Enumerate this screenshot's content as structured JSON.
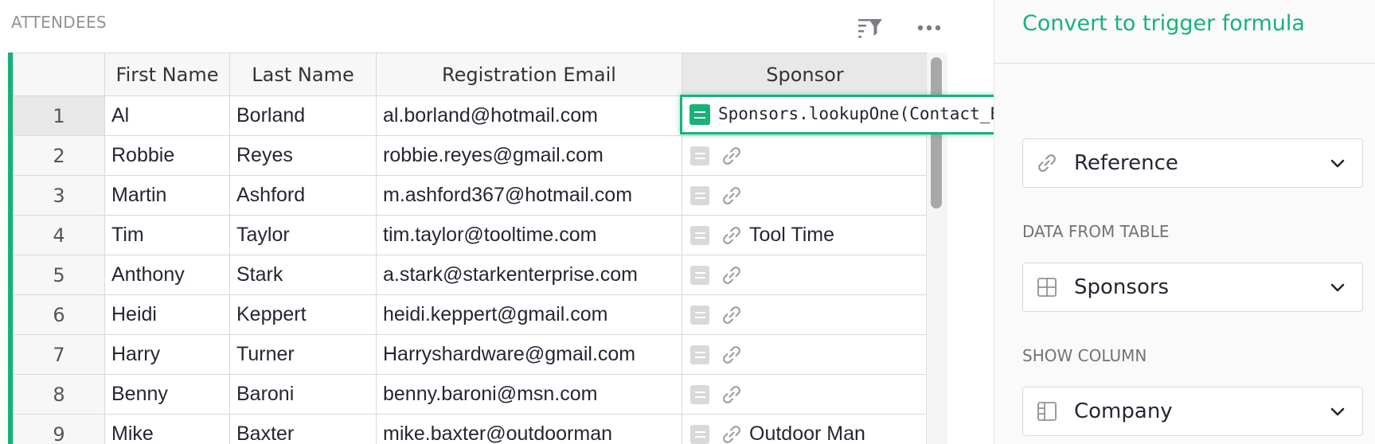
{
  "section": {
    "title": "ATTENDEES"
  },
  "columns": [
    "First Name",
    "Last Name",
    "Registration Email",
    "Sponsor"
  ],
  "rows": [
    {
      "num": "1",
      "first": "Al",
      "last": "Borland",
      "email": "al.borland@hotmail.com",
      "sponsor": ""
    },
    {
      "num": "2",
      "first": "Robbie",
      "last": "Reyes",
      "email": "robbie.reyes@gmail.com",
      "sponsor": ""
    },
    {
      "num": "3",
      "first": "Martin",
      "last": "Ashford",
      "email": "m.ashford367@hotmail.com",
      "sponsor": ""
    },
    {
      "num": "4",
      "first": "Tim",
      "last": "Taylor",
      "email": "tim.taylor@tooltime.com",
      "sponsor": "Tool Time"
    },
    {
      "num": "5",
      "first": "Anthony",
      "last": "Stark",
      "email": "a.stark@starkenterprise.com",
      "sponsor": ""
    },
    {
      "num": "6",
      "first": "Heidi",
      "last": "Keppert",
      "email": "heidi.keppert@gmail.com",
      "sponsor": ""
    },
    {
      "num": "7",
      "first": "Harry",
      "last": "Turner",
      "email": "Harryshardware@gmail.com",
      "sponsor": ""
    },
    {
      "num": "8",
      "first": "Benny",
      "last": "Baroni",
      "email": "benny.baroni@msn.com",
      "sponsor": ""
    },
    {
      "num": "9",
      "first": "Mike",
      "last": "Baxter",
      "email": "mike.baxter@outdoorman",
      "sponsor": "Outdoor Man"
    }
  ],
  "formula": {
    "text": "Sponsors.lookupOne(Contact_Email=$Registration_Email)"
  },
  "panel": {
    "trigger_link": "Convert to trigger formula",
    "type_select": "Reference",
    "data_from_table_label": "DATA FROM TABLE",
    "table_select": "Sponsors",
    "show_column_label": "SHOW COLUMN",
    "column_select": "Company"
  },
  "colors": {
    "accent": "#16b378",
    "muted": "#929299"
  },
  "icons": [
    "sort-filter-icon",
    "more-options-icon",
    "formula-icon",
    "link-icon",
    "chevron-down-icon",
    "table-icon",
    "column-icon"
  ]
}
